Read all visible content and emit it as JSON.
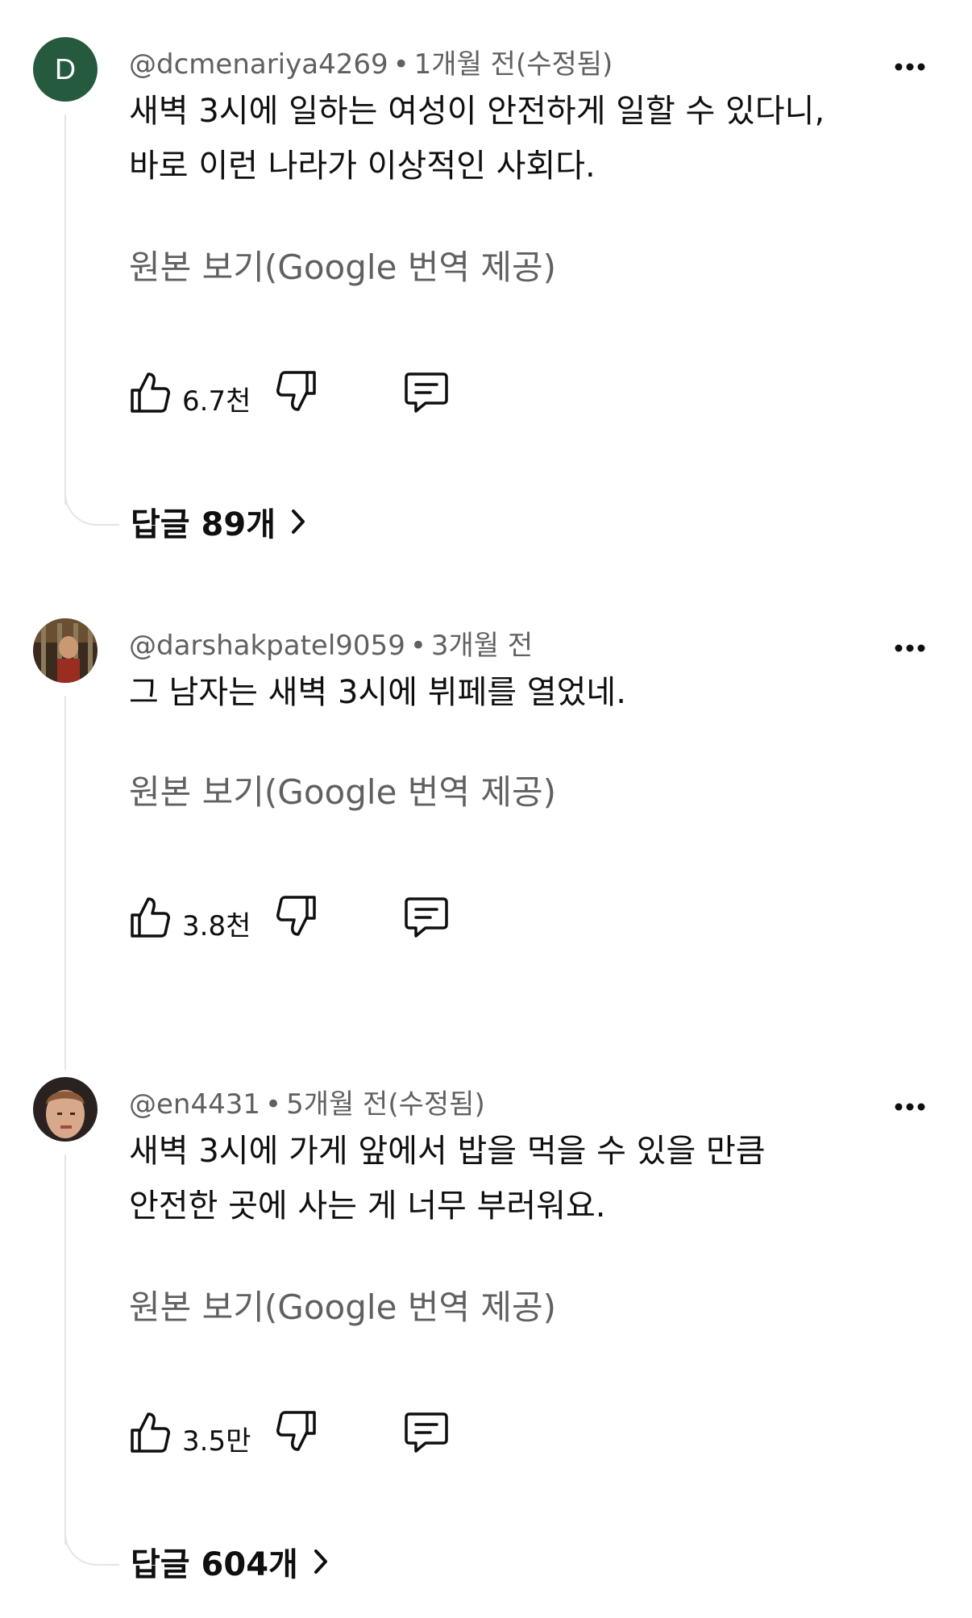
{
  "comments": [
    {
      "avatar_letter": "D",
      "avatar_color": "#255a3e",
      "username": "@dcmenariya4269",
      "separator": "•",
      "time": "1개월 전(수정됨)",
      "lines": [
        "새벽 3시에 일하는 여성이 안전하게 일할 수 있다니,",
        "바로 이런 나라가 이상적인 사회다."
      ],
      "translate_label": "원본 보기(Google 번역 제공)",
      "likes": "6.7천",
      "replies": "답글 89개"
    },
    {
      "avatar_desc": "photo-avatar",
      "username": "@darshakpatel9059",
      "separator": "•",
      "time": "3개월 전",
      "lines": [
        "그 남자는 새벽 3시에 뷔페를 열었네."
      ],
      "translate_label": "원본 보기(Google 번역 제공)",
      "likes": "3.8천"
    },
    {
      "avatar_desc": "photo-avatar",
      "username": "@en4431",
      "separator": "•",
      "time": "5개월 전(수정됨)",
      "lines": [
        "새벽 3시에 가게 앞에서 밥을 먹을 수 있을 만큼",
        "안전한 곳에 사는 게 너무 부러워요."
      ],
      "translate_label": "원본 보기(Google 번역 제공)",
      "likes": "3.5만",
      "replies": "답글 604개"
    }
  ],
  "icons": {
    "menu": "more-vertical-icon",
    "like": "thumb-up-icon",
    "dislike": "thumb-down-icon",
    "reply": "comment-icon",
    "chevron": "chevron-right-icon"
  }
}
